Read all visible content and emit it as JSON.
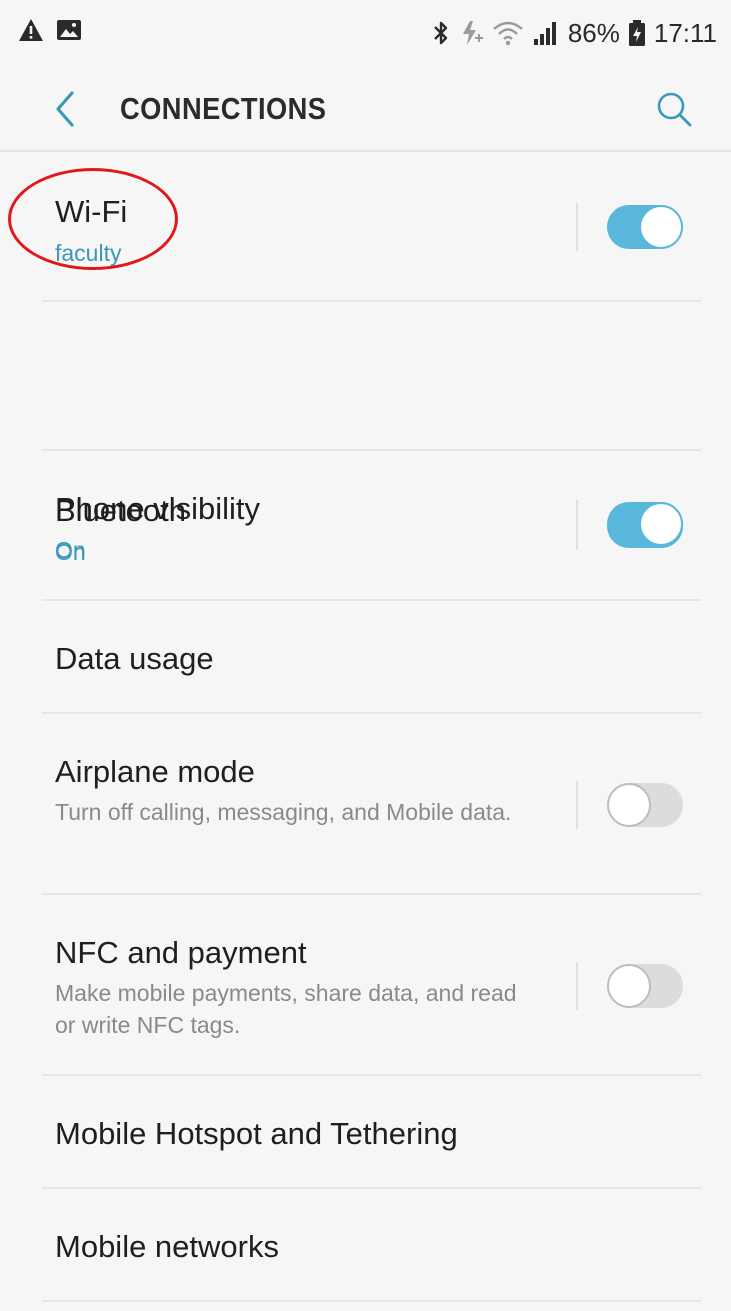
{
  "status_bar": {
    "left_icons": [
      "warning-icon",
      "image-icon"
    ],
    "right_icons": [
      "bluetooth-icon",
      "data-saver-icon",
      "wifi-icon",
      "signal-icon",
      "battery-icon"
    ],
    "battery_percent": "86%",
    "time": "17:11"
  },
  "header": {
    "title": "CONNECTIONS",
    "back_icon": "chevron-left-icon",
    "search_icon": "search-icon"
  },
  "colors": {
    "accent": "#58b7db",
    "subtitle": "#3a98b9",
    "annotation": "#e3171b"
  },
  "settings": {
    "wifi": {
      "title": "Wi-Fi",
      "subtitle": "faculty",
      "toggle": "on"
    },
    "bluetooth": {
      "title": "Bluetooth",
      "subtitle": "On",
      "toggle": "on"
    },
    "phone_visibility": {
      "title": "Phone visibility",
      "subtitle": "On",
      "toggle": "on"
    },
    "data_usage": {
      "title": "Data usage"
    },
    "airplane_mode": {
      "title": "Airplane mode",
      "description": "Turn off calling, messaging, and Mobile data.",
      "toggle": "off"
    },
    "nfc": {
      "title": "NFC and payment",
      "description": "Make mobile payments, share data, and read or write NFC tags.",
      "toggle": "off"
    },
    "hotspot": {
      "title": "Mobile Hotspot and Tethering"
    },
    "mobile_networks": {
      "title": "Mobile networks"
    }
  }
}
